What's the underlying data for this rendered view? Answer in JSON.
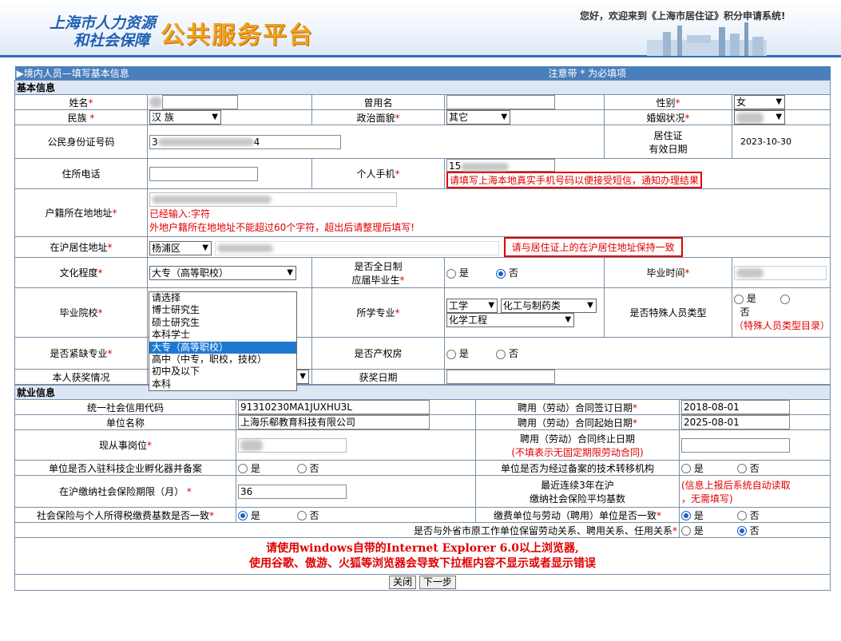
{
  "header": {
    "logo_line1": "上海市人力资源",
    "logo_line2": "和社会保障",
    "platform_title": "公共服务平台",
    "welcome": "您好，欢迎来到《上海市居住证》积分申请系统!"
  },
  "title_bar": {
    "breadcrumb": "▶境内人员—填写基本信息",
    "note": "注意带 * 为必填项"
  },
  "basic": {
    "section": "基本信息",
    "name_label": "姓名",
    "former_name_label": "曾用名",
    "gender_label": "性别",
    "gender_value": "女",
    "ethnicity_label": "民族 ",
    "ethnicity_value": "汉 族",
    "political_label": "政治面貌",
    "political_value": "其它",
    "marital_label": "婚姻状况",
    "id_label": "公民身份证号码",
    "id_value_start": "3",
    "id_value_end": "4",
    "permit_label_1": "居住证",
    "permit_label_2": "有效日期",
    "permit_value": "2023-10-30",
    "phone_label": "住所电话",
    "mobile_label": "个人手机",
    "mobile_value_start": "15",
    "mobile_hint": "请填写上海本地真实手机号码以便接受短信，通知办理结果",
    "household_label": "户籍所在地地址",
    "household_count": "已经输入:字符",
    "household_hint": "外地户籍所在地地址不能超过60个字符，超出后请整理后填写!",
    "sh_address_label": "在沪居住地址",
    "district_value": "杨浦区",
    "address_hint": "请与居住证上的在沪居住地址保持一致",
    "education_label": "文化程度",
    "education_value": "大专（高等职校）",
    "fulltime_label_1": "是否全日制",
    "fulltime_label_2": "应届毕业生",
    "yes": "是",
    "no": "否",
    "grad_time_label": "毕业时间",
    "school_label": "毕业院校",
    "major_label": "所学专业",
    "major_cat1": "工学",
    "major_cat2": "化工与制药类",
    "major_value": "化学工程",
    "special_label": "是否特殊人员类型",
    "special_link": "（特殊人员类型目录）",
    "shortage_label": "是否紧缺专业",
    "property_label": "是否产权房",
    "award_label": "本人获奖情况",
    "award_date_label": "获奖日期"
  },
  "education_options": [
    "请选择",
    "博士研究生",
    "硕士研究生",
    "本科学士",
    "大专（高等职校）",
    "高中（中专，职校，技校）",
    "初中及以下",
    "本科"
  ],
  "employment": {
    "section": "就业信息",
    "credit_code_label": "统一社会信用代码",
    "credit_code_value": "91310230MA1JUXHU3L",
    "contract_sign_label": "聘用（劳动）合同签订日期",
    "contract_sign_value": "2018-08-01",
    "unit_name_label": "单位名称",
    "unit_name_value": "上海乐郗教育科技有限公司",
    "contract_start_label": "聘用（劳动）合同起始日期",
    "contract_start_value": "2025-08-01",
    "position_label": "现从事岗位",
    "contract_end_label": "聘用（劳动）合同终止日期",
    "contract_end_note": "(不填表示无固定期限劳动合同)",
    "incubator_label": "单位是否入驻科技企业孵化器并备案",
    "tech_transfer_label": "单位是否为经过备案的技术转移机构",
    "social_months_label": "在沪缴纳社会保险期限（月）",
    "social_months_value": "36",
    "avg_base_label_1": "最近连续3年在沪",
    "avg_base_label_2": "缴纳社会保险平均基数",
    "auto_note_1": "(信息上报后系统自动读取",
    "auto_note_2": "，无需填写)",
    "tax_match_label": "社会保险与个人所得税缴费基数是否一致",
    "unit_match_label": "缴费单位与劳动（聘用）单位是否一致",
    "other_province_label": "是否与外省市原工作单位保留劳动关系、聘用关系、任用关系"
  },
  "footer": {
    "note_line1": "请使用windows自带的Internet Explorer 6.0以上浏览器,",
    "note_line2": "使用谷歌、傲游、火狐等浏览器会导致下拉框内容不显示或者显示错误",
    "close_button": "关闭",
    "next_button": "下一步"
  },
  "required_mark": "*"
}
